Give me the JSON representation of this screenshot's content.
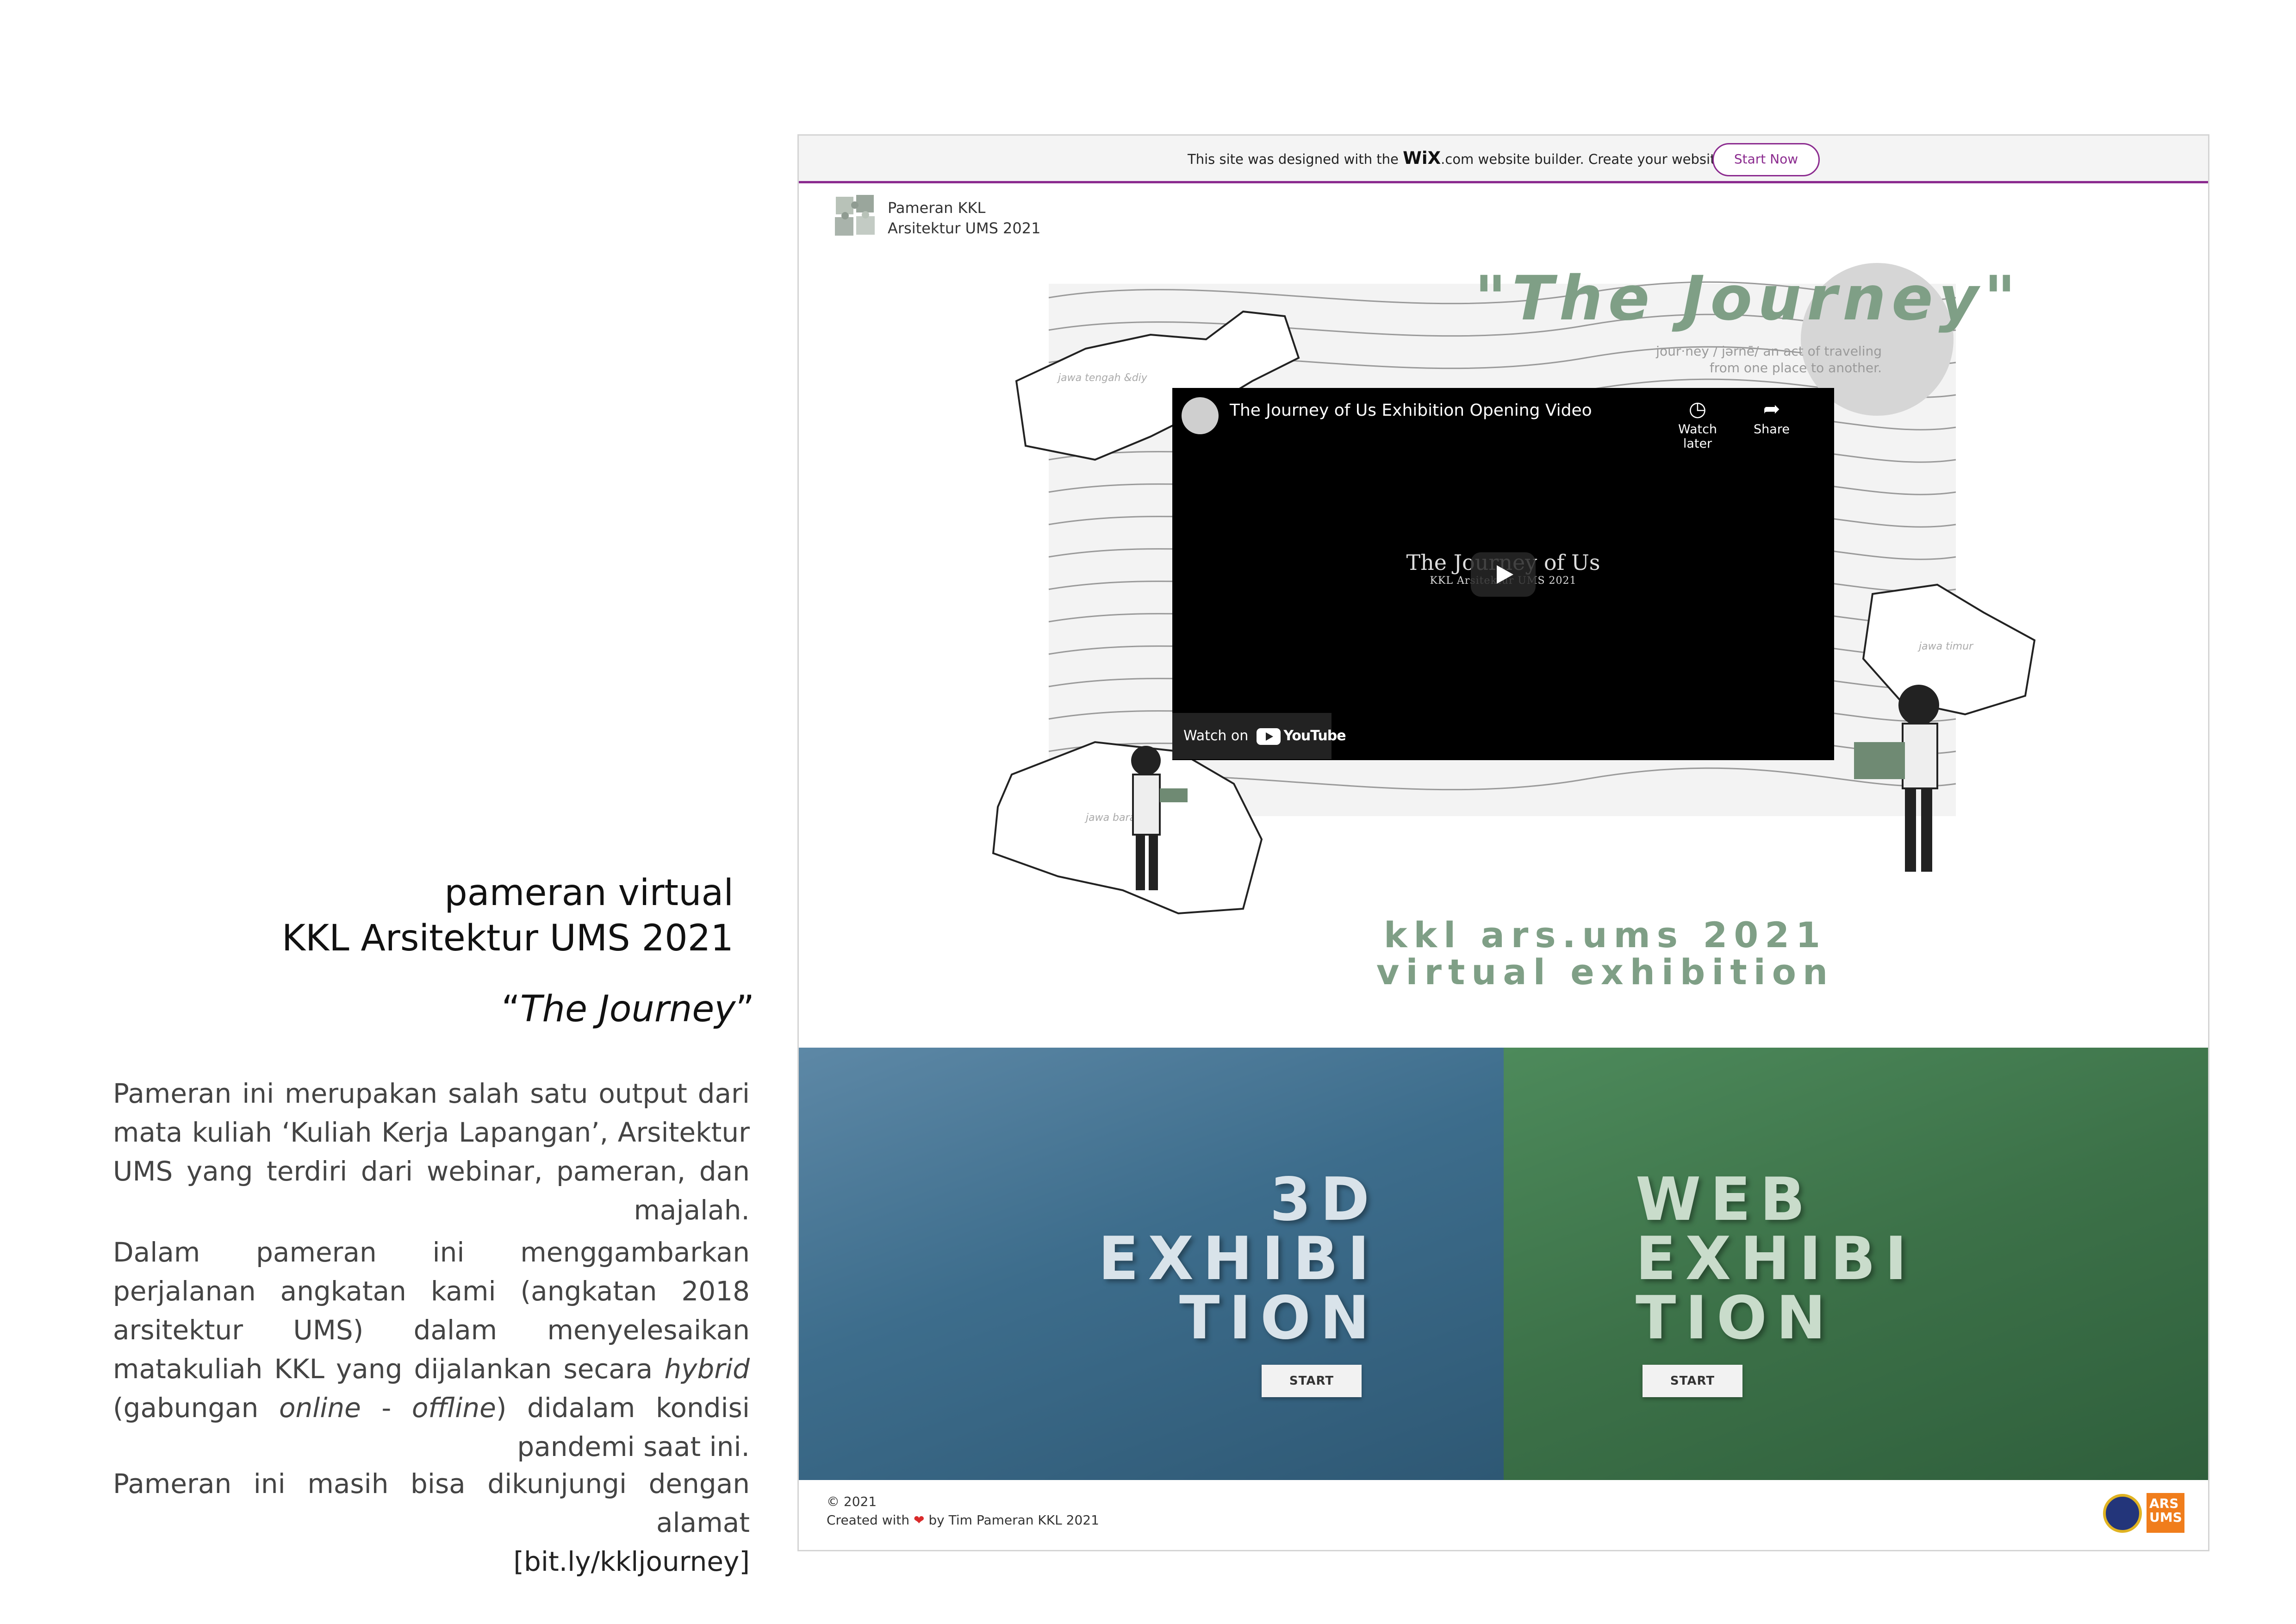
{
  "description": {
    "heading_line1": "pameran virtual",
    "heading_line2": "KKL Arsitektur UMS 2021",
    "subtitle_open": "“",
    "subtitle_italic": "The Journey",
    "subtitle_close": "”",
    "para1": "Pameran ini merupakan salah satu output dari mata kuliah ‘Kuliah Kerja Lapangan’, Arsitektur UMS yang terdiri dari webinar, pameran, dan majalah.",
    "para2_a": "Dalam pameran ini menggambarkan perjalanan angkatan kami (angkatan 2018 arsitektur UMS) dalam menyelesaikan matakuliah KKL yang dijalankan secara ",
    "para2_hybrid": "hybrid",
    "para2_b": " (gabungan ",
    "para2_online": "online",
    "para2_dash": " - ",
    "para2_offline": "offline",
    "para2_c": ") didalam kondisi pandemi saat ini.",
    "para3": "Pameran ini masih bisa dikunjungi dengan alamat",
    "link": "[bit.ly/kkljourney]"
  },
  "wix_banner": {
    "text_before": "This site was designed with the ",
    "logo": "WiX",
    "text_after": ".com website builder. Create your website today.",
    "button": "Start Now",
    "accent": "#8b2b8f"
  },
  "site": {
    "brand_line1": "Pameran KKL",
    "brand_line2": "Arsitektur UMS 2021",
    "hero_title": "\"The Journey\"",
    "definition": "jour·ney / jərnē/ an act of traveling from one place to another.",
    "map_labels": [
      "jawa tengah &diy",
      "jawa timur",
      "jawa barat"
    ],
    "tagline1": "kkl ars.ums 2021",
    "tagline2": "virtual exhibition",
    "accent_green": "#7f9f86"
  },
  "video": {
    "title": "The Journey of Us Exhibition Opening Video",
    "watch_later": "Watch later",
    "share": "Share",
    "center_title": "The Journey of Us",
    "center_sub": "KKL Arsitektur UMS 2021",
    "watch_on": "Watch on",
    "youtube": "YouTube"
  },
  "exhibitions": [
    {
      "title": "3D\nEXHIBI\nTION",
      "button": "START",
      "color": "#3d6d8c"
    },
    {
      "title": "WEB\nEXHIBI\nTION",
      "button": "START",
      "color": "#3c7148"
    }
  ],
  "footer": {
    "copyright": "© 2021",
    "made_before": "Created with ",
    "heart": "❤",
    "made_after": " by Tim Pameran KKL 2021",
    "logo2_text": "ARS\nUMS"
  }
}
